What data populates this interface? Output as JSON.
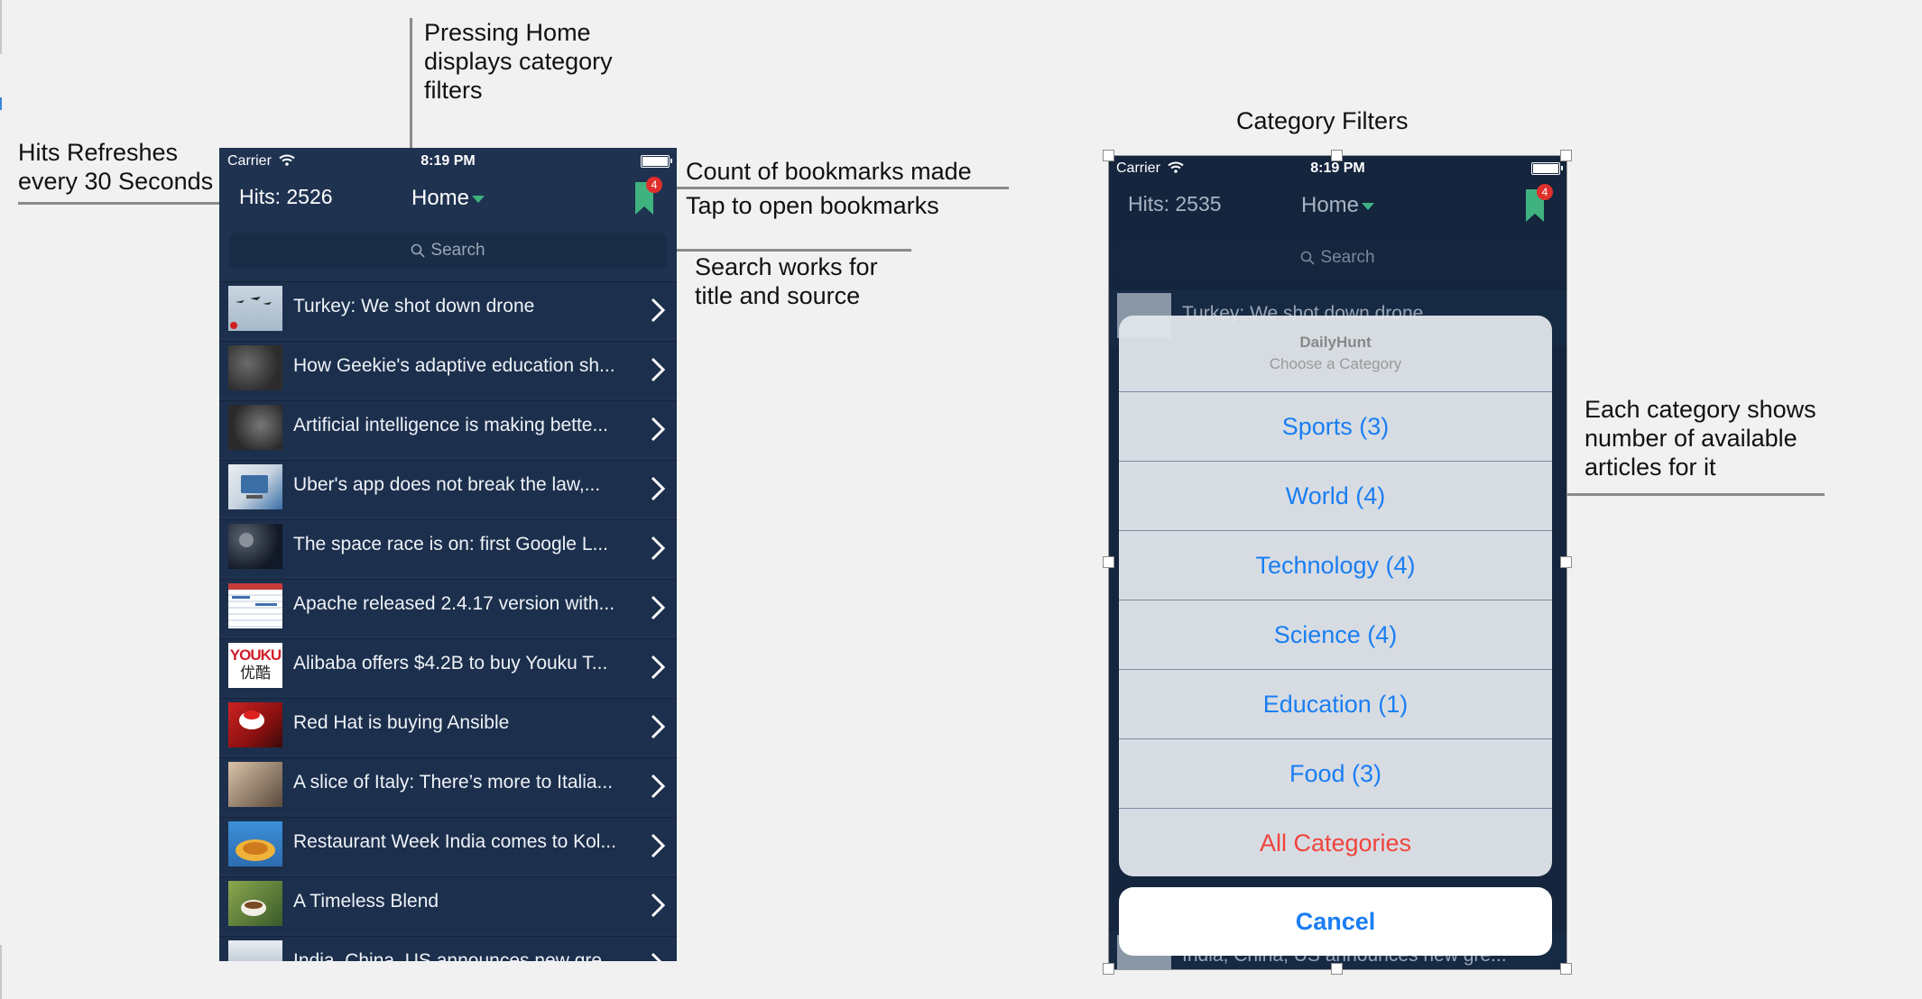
{
  "annotations": {
    "home": "Pressing Home\ndisplays category\nfilters",
    "hits": "Hits Refreshes\nevery 30 Seconds",
    "bookmark_count": "Count of bookmarks made",
    "bookmark_tap": "Tap to open bookmarks",
    "search": "Search works for\ntitle and source",
    "filters_title": "Category Filters",
    "category_count": "Each category shows\nnumber of available\narticles for it"
  },
  "left_phone": {
    "status": {
      "carrier": "Carrier",
      "time": "8:19 PM"
    },
    "nav": {
      "hits": "Hits: 2526",
      "title": "Home",
      "badge": "4"
    },
    "search_placeholder": "Search",
    "articles": [
      "Turkey: We shot down drone",
      "How Geekie's adaptive education sh...",
      "Artificial intelligence is making bette...",
      "Uber's app does not break the law,...",
      "The space race is on: first Google L...",
      "Apache released 2.4.17 version with...",
      "Alibaba offers $4.2B to buy Youku T...",
      "Red Hat is buying Ansible",
      "A slice of Italy: There’s more to Italia...",
      "Restaurant Week India comes to Kol...",
      "A Timeless Blend",
      "India, China, US announces new gre..."
    ]
  },
  "right_phone": {
    "status": {
      "carrier": "Carrier",
      "time": "8:19 PM"
    },
    "nav": {
      "hits": "Hits: 2535",
      "title": "Home",
      "badge": "4"
    },
    "search_placeholder": "Search",
    "background_articles": [
      "Turkey: We shot down drone",
      "India, China, US announces new gre..."
    ],
    "sheet": {
      "title": "DailyHunt",
      "subtitle": "Choose a Category",
      "options": [
        "Sports (3)",
        "World (4)",
        "Technology (4)",
        "Science (4)",
        "Education (1)",
        "Food (3)"
      ],
      "all": "All Categories",
      "cancel": "Cancel"
    }
  },
  "thumbnails": {
    "youku_top": "YOUKU",
    "youku_bottom": "优酷"
  },
  "colors": {
    "navy": "#1f3250",
    "row": "#1c2f4c",
    "accent_green": "#3fb27f",
    "ios_blue": "#1a7ef2",
    "destructive_red": "#f0443c",
    "badge_red": "#e0302b"
  }
}
